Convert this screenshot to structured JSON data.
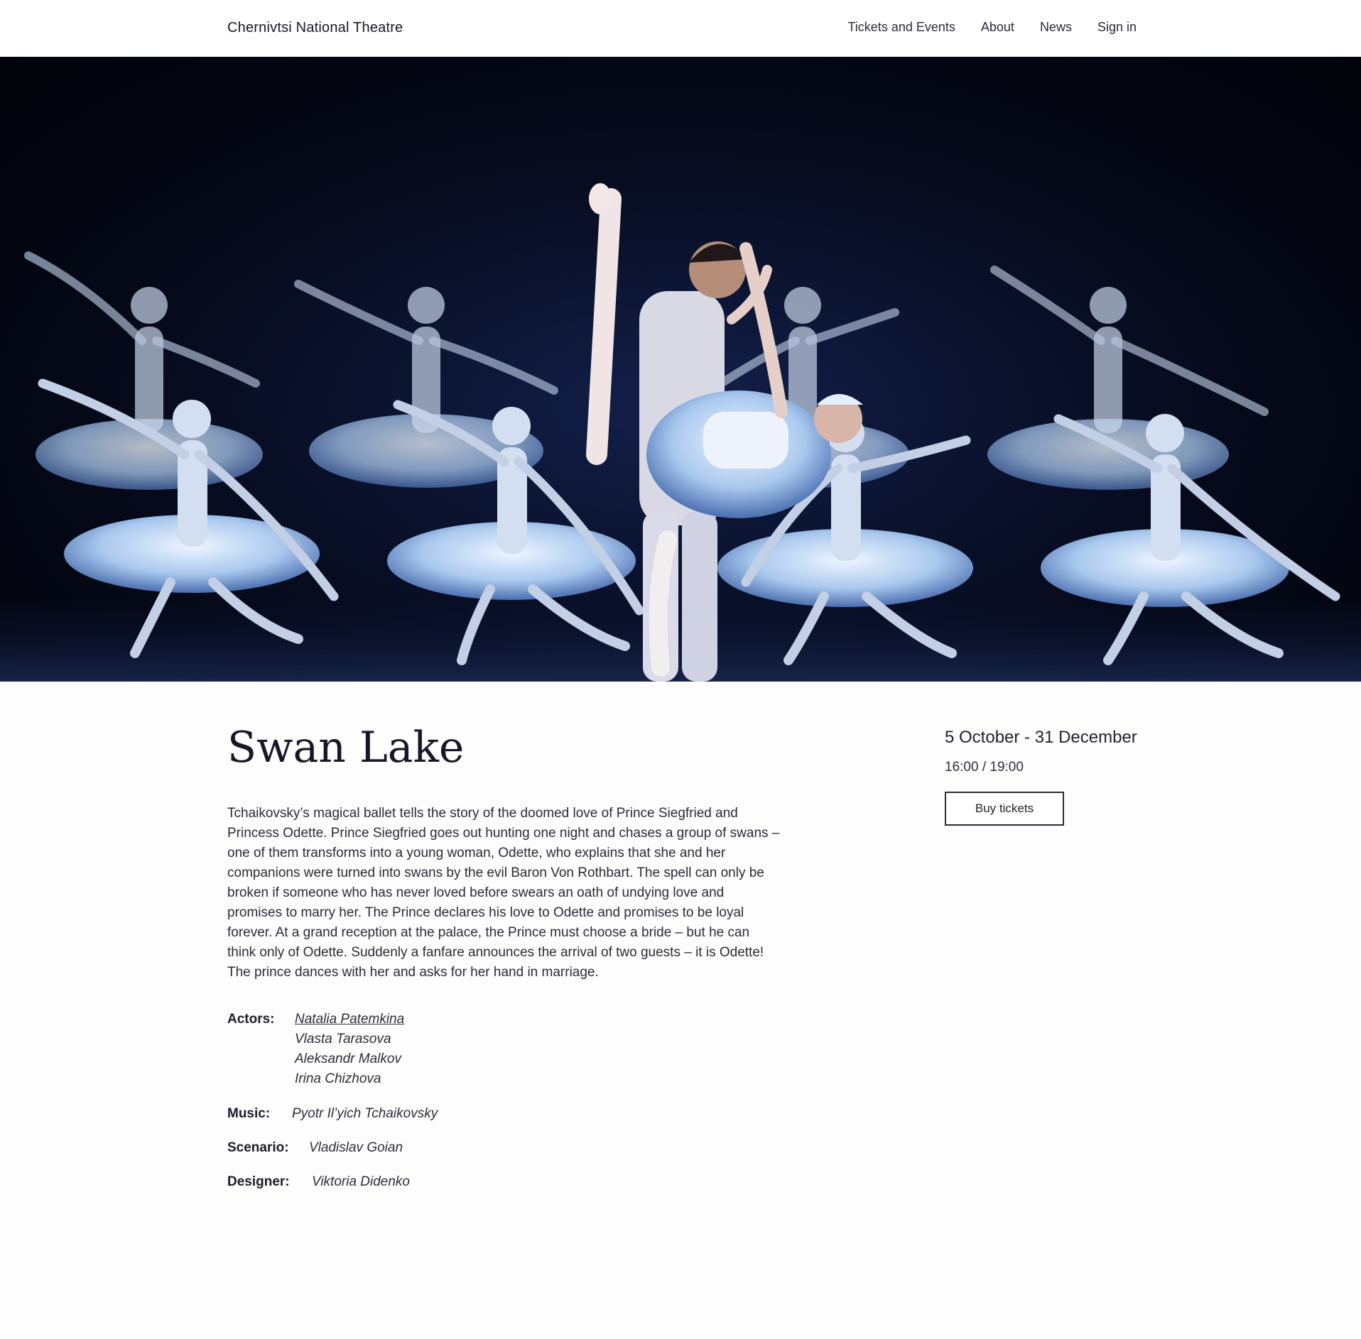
{
  "header": {
    "brand": "Chernivtsi National Theatre",
    "nav": {
      "tickets": "Tickets and Events",
      "about": "About",
      "news": "News",
      "signin": "Sign in"
    }
  },
  "hero": {
    "image_subject": "ballet-performance-photo"
  },
  "event": {
    "title": "Swan Lake",
    "description": "Tchaikovsky’s magical ballet tells the story of the doomed love of Prince Siegfried and Princess Odette. Prince Siegfried goes out hunting one night and chases a group of swans – one of them transforms into a young woman, Odette, who explains that she and her companions were turned into swans by the evil Baron Von Rothbart. The spell can only be broken if someone who has never loved before swears an oath of undying love and promises to marry her. The Prince declares his love to Odette and promises to be loyal forever. At a grand reception at the palace, the Prince must choose a bride – but he can think only of Odette. Suddenly a fanfare announces the arrival of two guests – it is Odette! The prince dances with her and asks for her hand in marriage.",
    "dates": "5 October - 31 December",
    "times": "16:00 / 19:00",
    "buy_label": "Buy tickets"
  },
  "credits": {
    "actors_label": "Actors:",
    "actors": [
      "Natalia Patemkina",
      "Vlasta Tarasova",
      "Aleksandr Malkov",
      "Irina Chizhova"
    ],
    "music_label": "Music:",
    "music": "Pyotr Il’yich Tchaikovsky",
    "scenario_label": "Scenario:",
    "scenario": "Vladislav Goian",
    "designer_label": "Designer:",
    "designer": "Viktoria Didenko"
  },
  "colors": {
    "text": "#1d1d2b",
    "hero_bg": "#050817",
    "tutu": "#c8e0f5"
  }
}
